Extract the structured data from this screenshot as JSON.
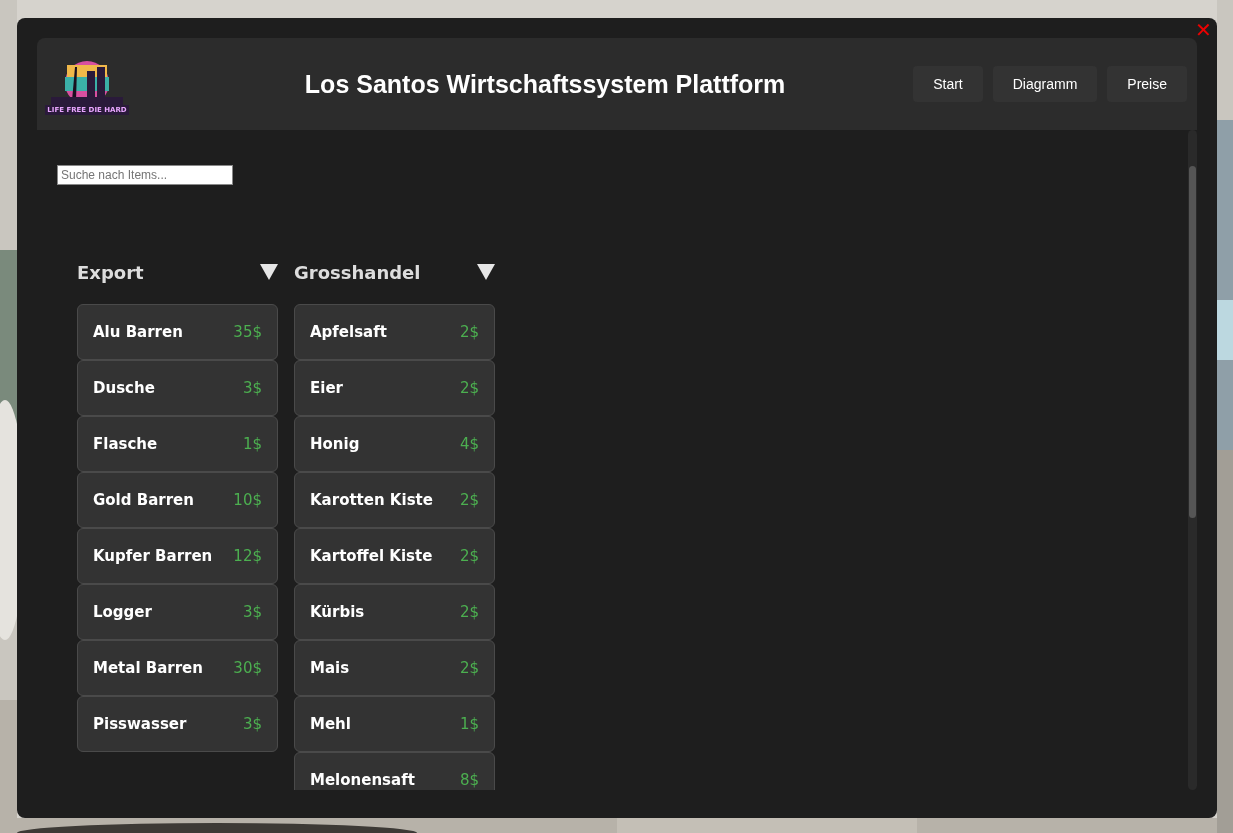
{
  "header": {
    "logo_text": "LIFE FREE DIE HARD",
    "title": "Los Santos Wirtschaftssystem Plattform",
    "nav": [
      {
        "label": "Start"
      },
      {
        "label": "Diagramm"
      },
      {
        "label": "Preise"
      }
    ]
  },
  "close": "✕",
  "search": {
    "placeholder": "Suche nach Items..."
  },
  "groups": [
    {
      "title": "Export",
      "expanded": true,
      "items": [
        {
          "name": "Alu Barren",
          "price": "35$"
        },
        {
          "name": "Dusche",
          "price": "3$"
        },
        {
          "name": "Flasche",
          "price": "1$"
        },
        {
          "name": "Gold Barren",
          "price": "10$"
        },
        {
          "name": "Kupfer Barren",
          "price": "12$"
        },
        {
          "name": "Logger",
          "price": "3$"
        },
        {
          "name": "Metal Barren",
          "price": "30$"
        },
        {
          "name": "Pisswasser",
          "price": "3$"
        }
      ]
    },
    {
      "title": "Grosshandel",
      "expanded": true,
      "items": [
        {
          "name": "Apfelsaft",
          "price": "2$"
        },
        {
          "name": "Eier",
          "price": "2$"
        },
        {
          "name": "Honig",
          "price": "4$"
        },
        {
          "name": "Karotten Kiste",
          "price": "2$"
        },
        {
          "name": "Kartoffel Kiste",
          "price": "2$"
        },
        {
          "name": "Kürbis",
          "price": "2$"
        },
        {
          "name": "Mais",
          "price": "2$"
        },
        {
          "name": "Mehl",
          "price": "1$"
        },
        {
          "name": "Melonensaft",
          "price": "8$"
        }
      ]
    }
  ]
}
